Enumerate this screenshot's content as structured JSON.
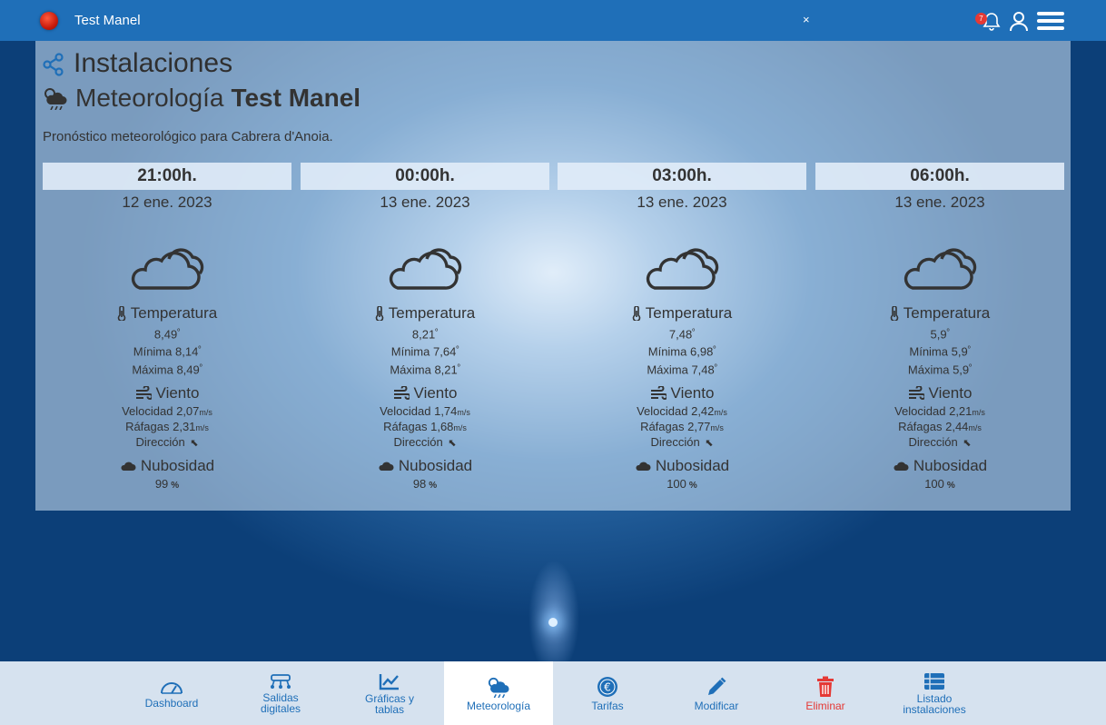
{
  "topbar": {
    "title": "Test Manel",
    "close": "×",
    "notifications": "7"
  },
  "header": {
    "section": "Instalaciones",
    "subtitle_light": "Meteorología",
    "subtitle_bold": "Test Manel",
    "forecast_text": "Pronóstico meteorológico para Cabrera d'Anoia."
  },
  "labels": {
    "temp": "Temperatura",
    "min": "Mínima",
    "max": "Máxima",
    "wind": "Viento",
    "speed": "Velocidad",
    "gusts": "Ráfagas",
    "direction": "Dirección",
    "cloud": "Nubosidad",
    "ms": "m/s",
    "deg": "º"
  },
  "cards": [
    {
      "time": "21:00h.",
      "date": "12 ene. 2023",
      "temp": "8,49",
      "min": "8,14",
      "max": "8,49",
      "speed": "2,07",
      "gusts": "2,31",
      "cloud": "99"
    },
    {
      "time": "00:00h.",
      "date": "13 ene. 2023",
      "temp": "8,21",
      "min": "7,64",
      "max": "8,21",
      "speed": "1,74",
      "gusts": "1,68",
      "cloud": "98"
    },
    {
      "time": "03:00h.",
      "date": "13 ene. 2023",
      "temp": "7,48",
      "min": "6,98",
      "max": "7,48",
      "speed": "2,42",
      "gusts": "2,77",
      "cloud": "100"
    },
    {
      "time": "06:00h.",
      "date": "13 ene. 2023",
      "temp": "5,9",
      "min": "5,9",
      "max": "5,9",
      "speed": "2,21",
      "gusts": "2,44",
      "cloud": "100"
    }
  ],
  "nav": {
    "dashboard": "Dashboard",
    "digital_outputs_1": "Salidas",
    "digital_outputs_2": "digitales",
    "charts_1": "Gráficas y",
    "charts_2": "tablas",
    "weather": "Meteorología",
    "rates": "Tarifas",
    "modify": "Modificar",
    "delete": "Eliminar",
    "list_1": "Listado",
    "list_2": "instalaciones"
  },
  "colors": {
    "brand": "#1f6fb8",
    "danger": "#e53935",
    "status": "#d9230f"
  },
  "icons": [
    "share-icon",
    "weather-rain-icon",
    "cloud-icon",
    "thermometer-icon",
    "wind-icon",
    "arrow-up-left-icon",
    "percent-icon",
    "bell-icon",
    "user-icon",
    "menu-icon",
    "gauge-icon",
    "network-icon",
    "line-chart-icon",
    "euro-icon",
    "pencil-icon",
    "trash-icon",
    "list-icon"
  ]
}
